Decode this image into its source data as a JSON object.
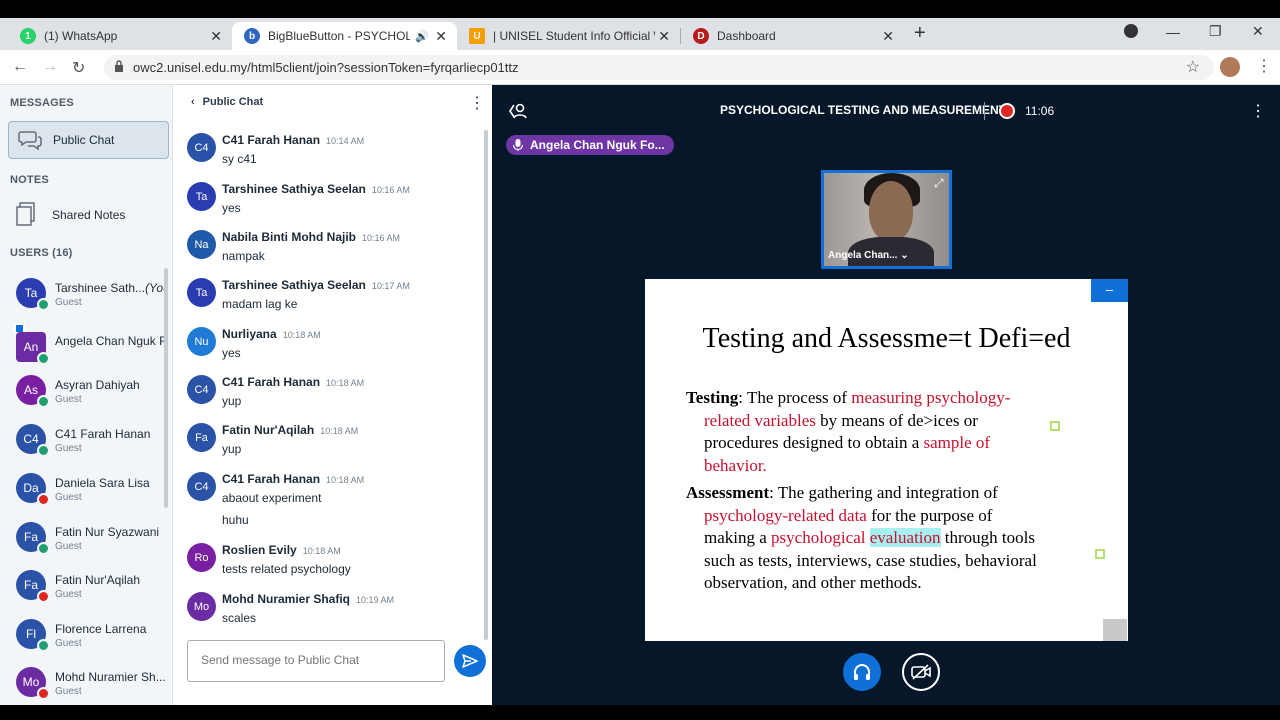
{
  "browser": {
    "tabs": [
      {
        "title": "(1) WhatsApp",
        "favicon_color": "#25d366"
      },
      {
        "title": "BigBlueButton - PSYCHOLOGICAL TESTING AND MEASUREMENT",
        "favicon_color": "#3066c3"
      },
      {
        "title": "| UNISEL Student Info Official Website",
        "favicon_color": "#f59e00"
      },
      {
        "title": "Dashboard",
        "favicon_color": "#b71c1c"
      }
    ],
    "url": "owc2.unisel.edu.my/html5client/join?sessionToken=fyrqarliecp01ttz"
  },
  "sidebar": {
    "messages_label": "MESSAGES",
    "public_chat_label": "Public Chat",
    "notes_label": "NOTES",
    "shared_notes_label": "Shared Notes",
    "users_label": "USERS (16)",
    "users": [
      {
        "initials": "Ta",
        "name": "Tarshinee Sath...",
        "you": "(You)",
        "role": "Guest",
        "color": "#2a3db0",
        "status": "green"
      },
      {
        "initials": "An",
        "name": "Angela Chan Nguk F...",
        "you": "",
        "role": "",
        "color": "#6a2ba3",
        "status": "green"
      },
      {
        "initials": "As",
        "name": "Asyran Dahiyah",
        "you": "",
        "role": "Guest",
        "color": "#7a1fa2",
        "status": "green"
      },
      {
        "initials": "C4",
        "name": "C41 Farah Hanan",
        "you": "",
        "role": "Guest",
        "color": "#2a52a6",
        "status": "green"
      },
      {
        "initials": "Da",
        "name": "Daniela Sara Lisa",
        "you": "",
        "role": "Guest",
        "color": "#2a52a6",
        "status": "red"
      },
      {
        "initials": "Fa",
        "name": "Fatin Nur Syazwani",
        "you": "",
        "role": "Guest",
        "color": "#2a52a6",
        "status": "green"
      },
      {
        "initials": "Fa",
        "name": "Fatin Nur'Aqilah",
        "you": "",
        "role": "Guest",
        "color": "#2a52a6",
        "status": "red"
      },
      {
        "initials": "Fl",
        "name": "Florence Larrena",
        "you": "",
        "role": "Guest",
        "color": "#2a52a6",
        "status": "green"
      },
      {
        "initials": "Mo",
        "name": "Mohd Nuramier Sh...",
        "you": "",
        "role": "Guest",
        "color": "#6a2ba3",
        "status": "red"
      }
    ]
  },
  "chat": {
    "header": "Public Chat",
    "messages": [
      {
        "initials": "C4",
        "name": "C41 Farah Hanan",
        "time": "10:14 AM",
        "text": "sy c41",
        "text2": "",
        "color": "#2a52a6"
      },
      {
        "initials": "Ta",
        "name": "Tarshinee Sathiya Seelan",
        "time": "10:16 AM",
        "text": "yes",
        "text2": "",
        "color": "#2a3db0"
      },
      {
        "initials": "Na",
        "name": "Nabila Binti Mohd Najib",
        "time": "10:16 AM",
        "text": "nampak",
        "text2": "",
        "color": "#1e5aa8"
      },
      {
        "initials": "Ta",
        "name": "Tarshinee Sathiya Seelan",
        "time": "10:17 AM",
        "text": "madam lag ke",
        "text2": "",
        "color": "#2a3db0"
      },
      {
        "initials": "Nu",
        "name": "Nurliyana",
        "time": "10:18 AM",
        "text": "yes",
        "text2": "",
        "color": "#1f7bd6"
      },
      {
        "initials": "C4",
        "name": "C41 Farah Hanan",
        "time": "10:18 AM",
        "text": "yup",
        "text2": "",
        "color": "#2a52a6"
      },
      {
        "initials": "Fa",
        "name": "Fatin Nur'Aqilah",
        "time": "10:18 AM",
        "text": "yup",
        "text2": "",
        "color": "#2a52a6"
      },
      {
        "initials": "C4",
        "name": "C41 Farah Hanan",
        "time": "10:18 AM",
        "text": "abaout experiment",
        "text2": "huhu",
        "color": "#2a52a6"
      },
      {
        "initials": "Ro",
        "name": "Roslien Evily",
        "time": "10:18 AM",
        "text": "tests related psychology",
        "text2": "",
        "color": "#7a1fa2"
      },
      {
        "initials": "Mo",
        "name": "Mohd Nuramier Shafiq",
        "time": "10:19 AM",
        "text": "scales",
        "text2": "",
        "color": "#6a2ba3"
      }
    ],
    "input_placeholder": "Send message to Public Chat"
  },
  "meeting": {
    "title": "PSYCHOLOGICAL TESTING AND MEASUREMENT",
    "record_time": "11:06",
    "talking": "Angela Chan Nguk Fo...",
    "webcam_name": "Angela Chan..."
  },
  "slide": {
    "title": "Testing and Assessme=t Defi=ed",
    "testing_term": "Testing",
    "testing_lines": [
      ": The process of ",
      "measuring psychology-",
      "related variables",
      " by means of de>ices or",
      "procedures designed to obtain a ",
      "sample of",
      "behavior."
    ],
    "assessment_term": "Assessment",
    "assessment_lines": [
      ": The gathering and integration of",
      "psychology-related data",
      " for the purpose of",
      "making a ",
      "psychological",
      "evaluation",
      " through tools",
      "such as tests, interviews, case studies, behavioral",
      "observation, and other methods."
    ]
  },
  "colors": {
    "accent": "#0f70d7",
    "main_bg": "#06172a",
    "record": "#df2721"
  }
}
